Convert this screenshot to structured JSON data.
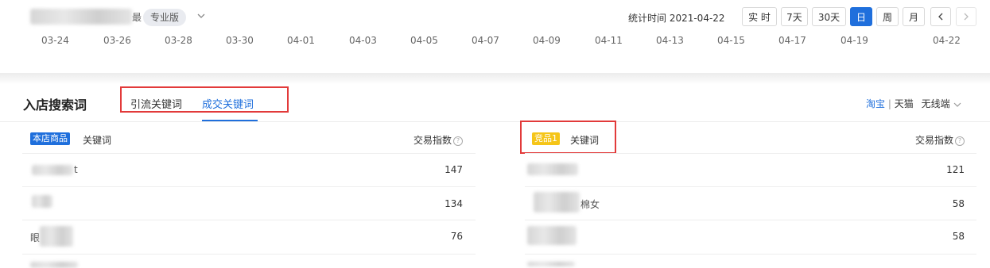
{
  "header": {
    "shop_name_visible": "最",
    "edition_label": "专业版",
    "stat_time": "统计时间 2021-04-22",
    "time_buttons": [
      "实 时",
      "7天",
      "30天",
      "日",
      "周",
      "月"
    ],
    "active_button": "日"
  },
  "axis": {
    "ticks": [
      "03-24",
      "03-26",
      "03-28",
      "03-30",
      "04-01",
      "04-03",
      "04-05",
      "04-07",
      "04-09",
      "04-11",
      "04-13",
      "04-15",
      "04-17",
      "04-19",
      "04-22"
    ]
  },
  "section": {
    "title": "入店搜索词",
    "tabs": [
      {
        "label": "引流关键词",
        "active": false
      },
      {
        "label": "成交关键词",
        "active": true
      }
    ],
    "platforms": {
      "taobao": "淘宝",
      "sep": "|",
      "tmall": "天猫",
      "device": "无线端"
    }
  },
  "left_table": {
    "badge": "本店商品",
    "header": "关键词",
    "metric": "交易指数",
    "rows": [
      {
        "keyword_visible": "t",
        "value": "147"
      },
      {
        "keyword_visible": "",
        "value": "134"
      },
      {
        "keyword_visible": "眼",
        "value": "76"
      }
    ]
  },
  "right_table": {
    "badge": "竞品1",
    "header": "关键词",
    "metric": "交易指数",
    "rows": [
      {
        "keyword_visible": "",
        "value": "121"
      },
      {
        "keyword_visible": "棉女",
        "value": "58"
      },
      {
        "keyword_visible": "",
        "value": "58"
      }
    ]
  },
  "colors": {
    "accent": "#1f6fdc",
    "highlight_box": "#e23a3a",
    "badge_blue": "#1f6fdc",
    "badge_yellow": "#f5c518"
  }
}
